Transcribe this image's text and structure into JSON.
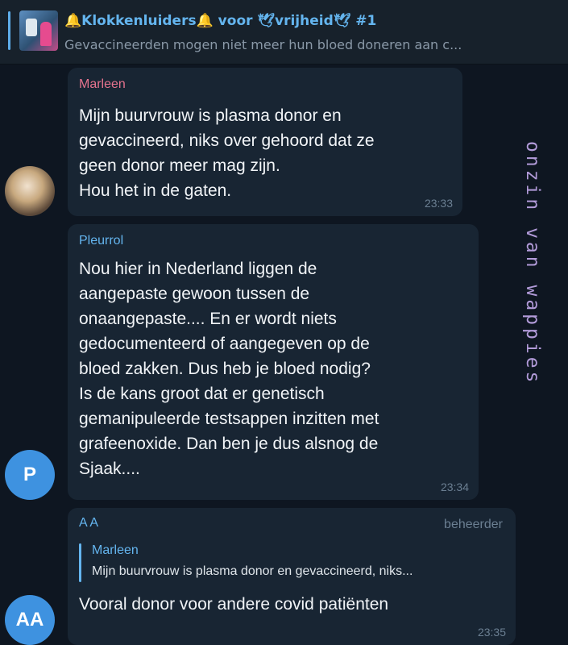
{
  "pinned": {
    "title": "🔔Klokkenluiders🔔 voor 🕊vrijheid🕊 #1",
    "text": "Gevaccineerden mogen niet meer hun bloed doneren aan c..."
  },
  "watermark": "onzin van wappies",
  "messages": [
    {
      "sender": "Marleen",
      "sender_color": "#e5738e",
      "text": "Mijn buurvrouw is plasma donor en\ngevaccineerd, niks over gehoord dat ze\ngeen donor meer mag zijn.\nHou het in de gaten.",
      "time": "23:33"
    },
    {
      "sender": "Pleurrol",
      "sender_color": "#64b5ef",
      "avatar_initials": "P",
      "text": "Nou hier in Nederland liggen de\naangepaste gewoon tussen de\nonaangepaste.... En er wordt niets\ngedocumenteerd of aangegeven op de\nbloed zakken. Dus heb je bloed nodig?\nIs de kans groot dat er genetisch\ngemanipuleerde testsappen inzitten met\ngrafeenoxide. Dan ben je dus alsnog de\nSjaak....",
      "time": "23:34"
    },
    {
      "sender": "A A",
      "sender_color": "#64b5ef",
      "avatar_initials": "AA",
      "role": "beheerder",
      "reply": {
        "sender": "Marleen",
        "text": "Mijn buurvrouw is plasma donor en gevaccineerd, niks..."
      },
      "text": "Vooral donor voor andere covid patiënten",
      "time": "23:35"
    }
  ]
}
